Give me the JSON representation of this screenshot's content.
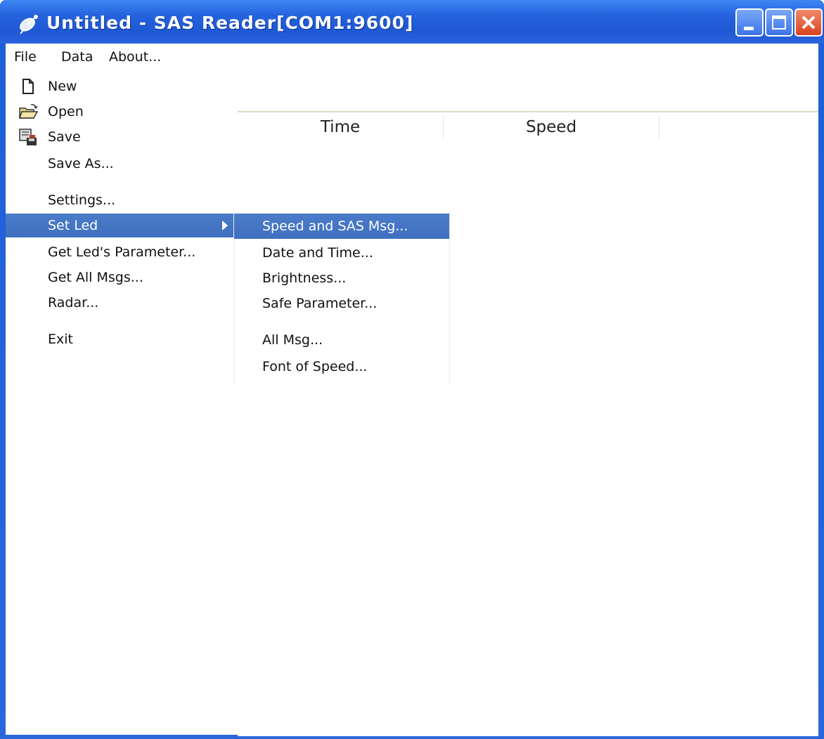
{
  "window": {
    "title": "Untitled - SAS Reader[COM1:9600]",
    "title_icon": "satellite-dish-icon",
    "colors": {
      "titlebar": "#2563de",
      "close_button": "#d9431e",
      "menu_highlight": "#4b7cc9"
    }
  },
  "menubar": {
    "items": [
      "File",
      "Data",
      "About..."
    ]
  },
  "listview": {
    "columns": [
      "Time",
      "Speed"
    ]
  },
  "file_menu": {
    "items": [
      {
        "label": "New",
        "icon": "new-document-icon"
      },
      {
        "label": "Open",
        "icon": "open-folder-icon"
      },
      {
        "label": "Save",
        "icon": "save-icon"
      },
      {
        "label": "Save As..."
      },
      {
        "label": "Settings..."
      },
      {
        "label": "Set Led",
        "highlighted": true,
        "has_submenu": true
      },
      {
        "label": "Get Led's Parameter..."
      },
      {
        "label": "Get All Msgs..."
      },
      {
        "label": "Radar..."
      },
      {
        "label": "Exit"
      }
    ]
  },
  "set_led_submenu": {
    "items": [
      {
        "label": "Speed and SAS Msg...",
        "highlighted": true
      },
      {
        "label": "Date and Time..."
      },
      {
        "label": "Brightness..."
      },
      {
        "label": "Safe Parameter..."
      },
      {
        "label": "All Msg..."
      },
      {
        "label": "Font of Speed..."
      }
    ]
  }
}
